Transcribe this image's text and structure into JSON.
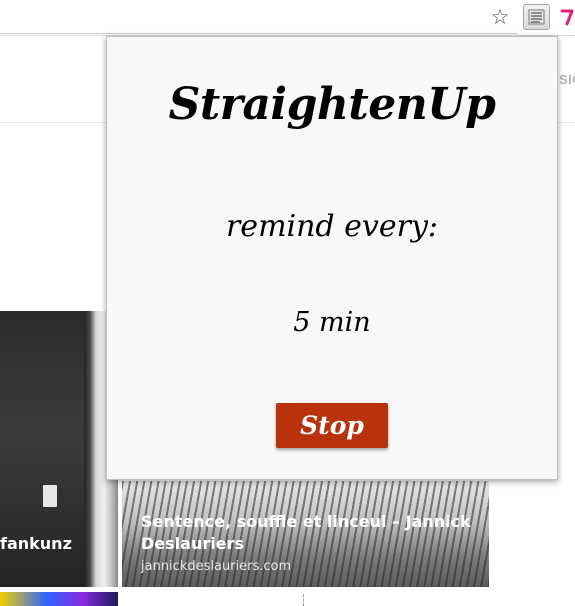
{
  "toolbar": {
    "bookmark_icon": "star-icon",
    "extension_icon": "straightenup-extension-icon",
    "extension2_icon": "pink-extension-icon",
    "colors": {
      "accent_pink": "#e8207a"
    }
  },
  "page": {
    "nav_fragment": "SIC",
    "cards": [
      {
        "caption": "fankunz"
      },
      {
        "title": "Sentence, souffle et linceul – Jannick Deslauriers",
        "source": "jannickdeslauriers.com"
      }
    ]
  },
  "popup": {
    "title": "StraightenUp",
    "label": "remind every:",
    "value": "5 min",
    "stop_label": "Stop",
    "colors": {
      "background": "#f8f8f8",
      "button": "#b8320c"
    }
  }
}
